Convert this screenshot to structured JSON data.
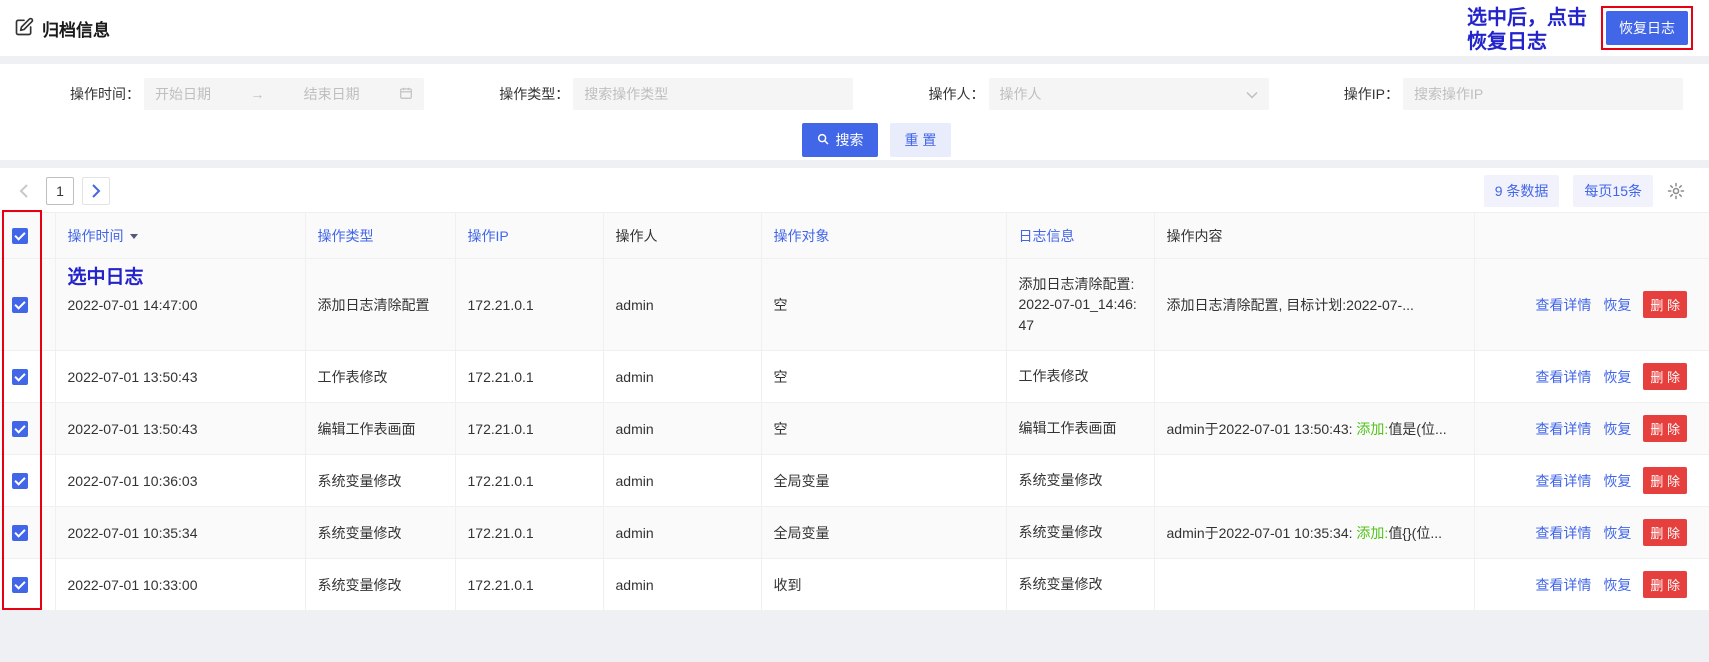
{
  "header": {
    "title": "归档信息",
    "restore_log_button": "恢复日志",
    "annotation": {
      "line1": "选中后，点击",
      "line2": "恢复日志"
    }
  },
  "filters": {
    "time": {
      "label": "操作时间：",
      "start_placeholder": "开始日期",
      "separator": "→",
      "end_placeholder": "结束日期"
    },
    "type": {
      "label": "操作类型：",
      "placeholder": "搜索操作类型"
    },
    "operator": {
      "label": "操作人：",
      "placeholder": "操作人"
    },
    "ip": {
      "label": "操作IP：",
      "placeholder": "搜索操作IP"
    },
    "search_button": "搜索",
    "reset_button": "重 置"
  },
  "pagination": {
    "prev_icon": "<",
    "page": "1",
    "next_icon": ">",
    "total_badge": "9 条数据",
    "page_size_badge": "每页15条"
  },
  "table": {
    "headers": {
      "time": "操作时间",
      "type": "操作类型",
      "ip": "操作IP",
      "operator": "操作人",
      "target": "操作对象",
      "log_info": "日志信息",
      "content": "操作内容"
    },
    "row_annotation": "选中日志",
    "action_labels": {
      "view": "查看详情",
      "restore": "恢复",
      "delete": "删 除"
    },
    "rows": [
      {
        "time": "2022-07-01 14:47:00",
        "type": "添加日志清除配置",
        "ip": "172.21.0.1",
        "operator": "admin",
        "target": "空",
        "log_info": "添加日志清除配置: 2022-07-01_14:46:47",
        "content_pre": "添加日志清除配置, 目标计划:2022-07-...",
        "content_green": "",
        "content_post": ""
      },
      {
        "time": "2022-07-01 13:50:43",
        "type": "工作表修改",
        "ip": "172.21.0.1",
        "operator": "admin",
        "target": "空",
        "log_info": "工作表修改",
        "content_pre": "",
        "content_green": "",
        "content_post": ""
      },
      {
        "time": "2022-07-01 13:50:43",
        "type": "编辑工作表画面",
        "ip": "172.21.0.1",
        "operator": "admin",
        "target": "空",
        "log_info": "编辑工作表画面",
        "content_pre": "admin于2022-07-01 13:50:43: ",
        "content_green": "添加:",
        "content_post": "值是(位..."
      },
      {
        "time": "2022-07-01 10:36:03",
        "type": "系统变量修改",
        "ip": "172.21.0.1",
        "operator": "admin",
        "target": "全局变量",
        "log_info": "系统变量修改",
        "content_pre": "",
        "content_green": "",
        "content_post": ""
      },
      {
        "time": "2022-07-01 10:35:34",
        "type": "系统变量修改",
        "ip": "172.21.0.1",
        "operator": "admin",
        "target": "全局变量",
        "log_info": "系统变量修改",
        "content_pre": "admin于2022-07-01 10:35:34: ",
        "content_green": "添加:",
        "content_post": "值{}(位..."
      },
      {
        "time": "2022-07-01 10:33:00",
        "type": "系统变量修改",
        "ip": "172.21.0.1",
        "operator": "admin",
        "target": "收到",
        "log_info": "系统变量修改",
        "content_pre": "",
        "content_green": "",
        "content_post": ""
      }
    ]
  },
  "colors": {
    "accent": "#4266e8",
    "danger": "#e5403d",
    "success_text": "#52c41a",
    "annotation_box": "#e60012",
    "annotation_text": "#2323cb"
  }
}
